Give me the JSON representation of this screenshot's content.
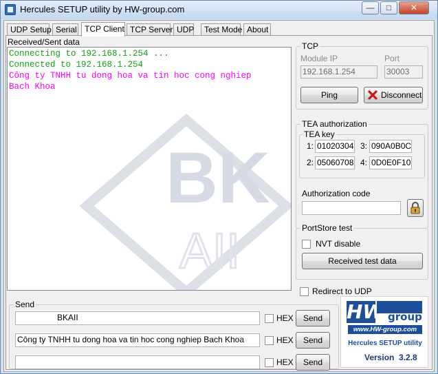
{
  "window": {
    "title": "Hercules SETUP utility by HW-group.com",
    "controls": {
      "minimize": "—",
      "maximize": "□",
      "close": "✕"
    }
  },
  "tabs": [
    "UDP Setup",
    "Serial",
    "TCP Client",
    "TCP Server",
    "UDP",
    "Test Mode",
    "About"
  ],
  "active_tab": "TCP Client",
  "received": {
    "label": "Received/Sent data",
    "lines": [
      {
        "text": "Connecting to 192.168.1.254 ...",
        "color": "#16a016"
      },
      {
        "text": "Connected to 192.168.1.254",
        "color": "#16a016"
      },
      {
        "text": "Công ty TNHH tu dong hoa va tin hoc cong nghiep",
        "color": "#ff00ff"
      },
      {
        "text": "Bach Khoa",
        "color": "#ff00ff"
      }
    ]
  },
  "tcp": {
    "group_title": "TCP",
    "module_ip_label": "Module IP",
    "module_ip": "192.168.1.254",
    "port_label": "Port",
    "port": "30003",
    "ping_label": "Ping",
    "disconnect_label": "Disconnect"
  },
  "tea": {
    "group_title": "TEA authorization",
    "key_title": "TEA key",
    "keys": [
      {
        "index": "1:",
        "value": "01020304"
      },
      {
        "index": "3:",
        "value": "090A0B0C"
      },
      {
        "index": "2:",
        "value": "05060708"
      },
      {
        "index": "4:",
        "value": "0D0E0F10"
      }
    ],
    "auth_code_label": "Authorization code",
    "auth_code_value": ""
  },
  "portstore": {
    "group_title": "PortStore test",
    "nvt_label": "NVT disable",
    "received_test_label": "Received test data"
  },
  "redirect_label": "Redirect to UDP",
  "send": {
    "group_title": "Send",
    "rows": [
      {
        "value": "BKAII",
        "hex_label": "HEX",
        "button_label": "Send"
      },
      {
        "value": "Công ty TNHH tu dong hoa va tin hoc cong nghiep Bach Khoa",
        "hex_label": "HEX",
        "button_label": "Send"
      },
      {
        "value": "",
        "hex_label": "HEX",
        "button_label": "Send"
      }
    ]
  },
  "logo": {
    "brand_hw": "HW",
    "brand_group": "group",
    "url": "www.HW-group.com",
    "product": "Hercules SETUP utility",
    "version": "Version  3.2.8",
    "watermark_letters": "BK",
    "watermark_sub": "AII"
  },
  "colors": {
    "accent_blue": "#1d4e9a",
    "watermark": "#d9dde6"
  }
}
